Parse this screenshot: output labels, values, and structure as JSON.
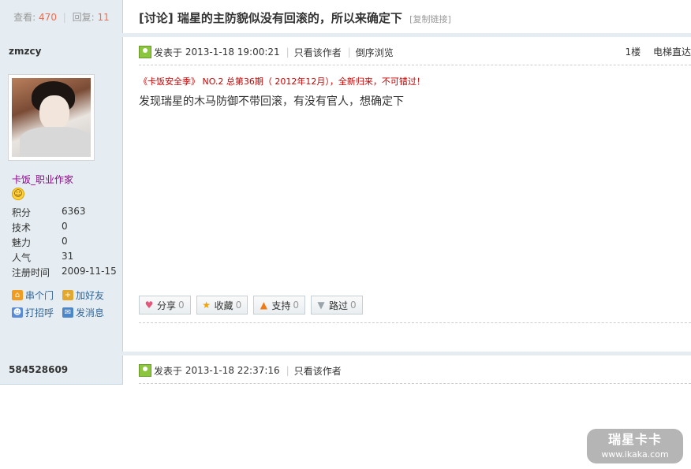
{
  "thread": {
    "views_label": "查看:",
    "views": "470",
    "replies_label": "回复:",
    "replies": "11",
    "title": "[讨论] 瑞星的主防貌似没有回滚的，所以来确定下",
    "copy_link": "[复制链接]"
  },
  "posts": [
    {
      "author": "zmzcy",
      "posted_label": "发表于",
      "posted_at": "2013-1-18 19:00:21",
      "only_author": "只看该作者",
      "reverse": "倒序浏览",
      "floor": "1楼",
      "elevator": "电梯直达",
      "promo": "《卡饭安全季》 NO.2 总第36期（ 2012年12月），全新归来，不可错过！",
      "body": "发现瑞星的木马防御不带回滚，有没有官人，想确定下",
      "user_title": "卡饭_职业作家",
      "stats": [
        {
          "k": "积分",
          "v": "6363"
        },
        {
          "k": "技术",
          "v": "0"
        },
        {
          "k": "魅力",
          "v": "0"
        },
        {
          "k": "人气",
          "v": "31"
        },
        {
          "k": "注册时间",
          "v": "2009-11-15"
        }
      ],
      "actions": {
        "visit": "串个门",
        "add_friend": "加好友",
        "greet": "打招呼",
        "message": "发消息"
      },
      "buttons": {
        "share": "分享",
        "share_count": "0",
        "favorite": "收藏",
        "favorite_count": "0",
        "support": "支持",
        "support_count": "0",
        "pass": "路过",
        "pass_count": "0"
      }
    },
    {
      "author": "584528609",
      "posted_label": "发表于",
      "posted_at": "2013-1-18 22:37:16",
      "only_author": "只看该作者"
    }
  ],
  "watermark": {
    "line1": "瑞星卡卡",
    "line2": "www.ikaka.com"
  },
  "icons": {
    "online": "user-online-icon",
    "smile": "smile-icon",
    "home": "home-icon",
    "friend": "add-friend-icon",
    "hello": "greet-icon",
    "message": "message-icon",
    "heart": "heart-icon",
    "star": "star-icon",
    "up": "arrow-up-icon",
    "down": "arrow-down-icon"
  },
  "colors": {
    "sidebar": "#e5edf2",
    "accent_number": "#f26c4f",
    "user_title": "#8b0a8b",
    "promo": "#cc0000",
    "link": "#336699"
  }
}
